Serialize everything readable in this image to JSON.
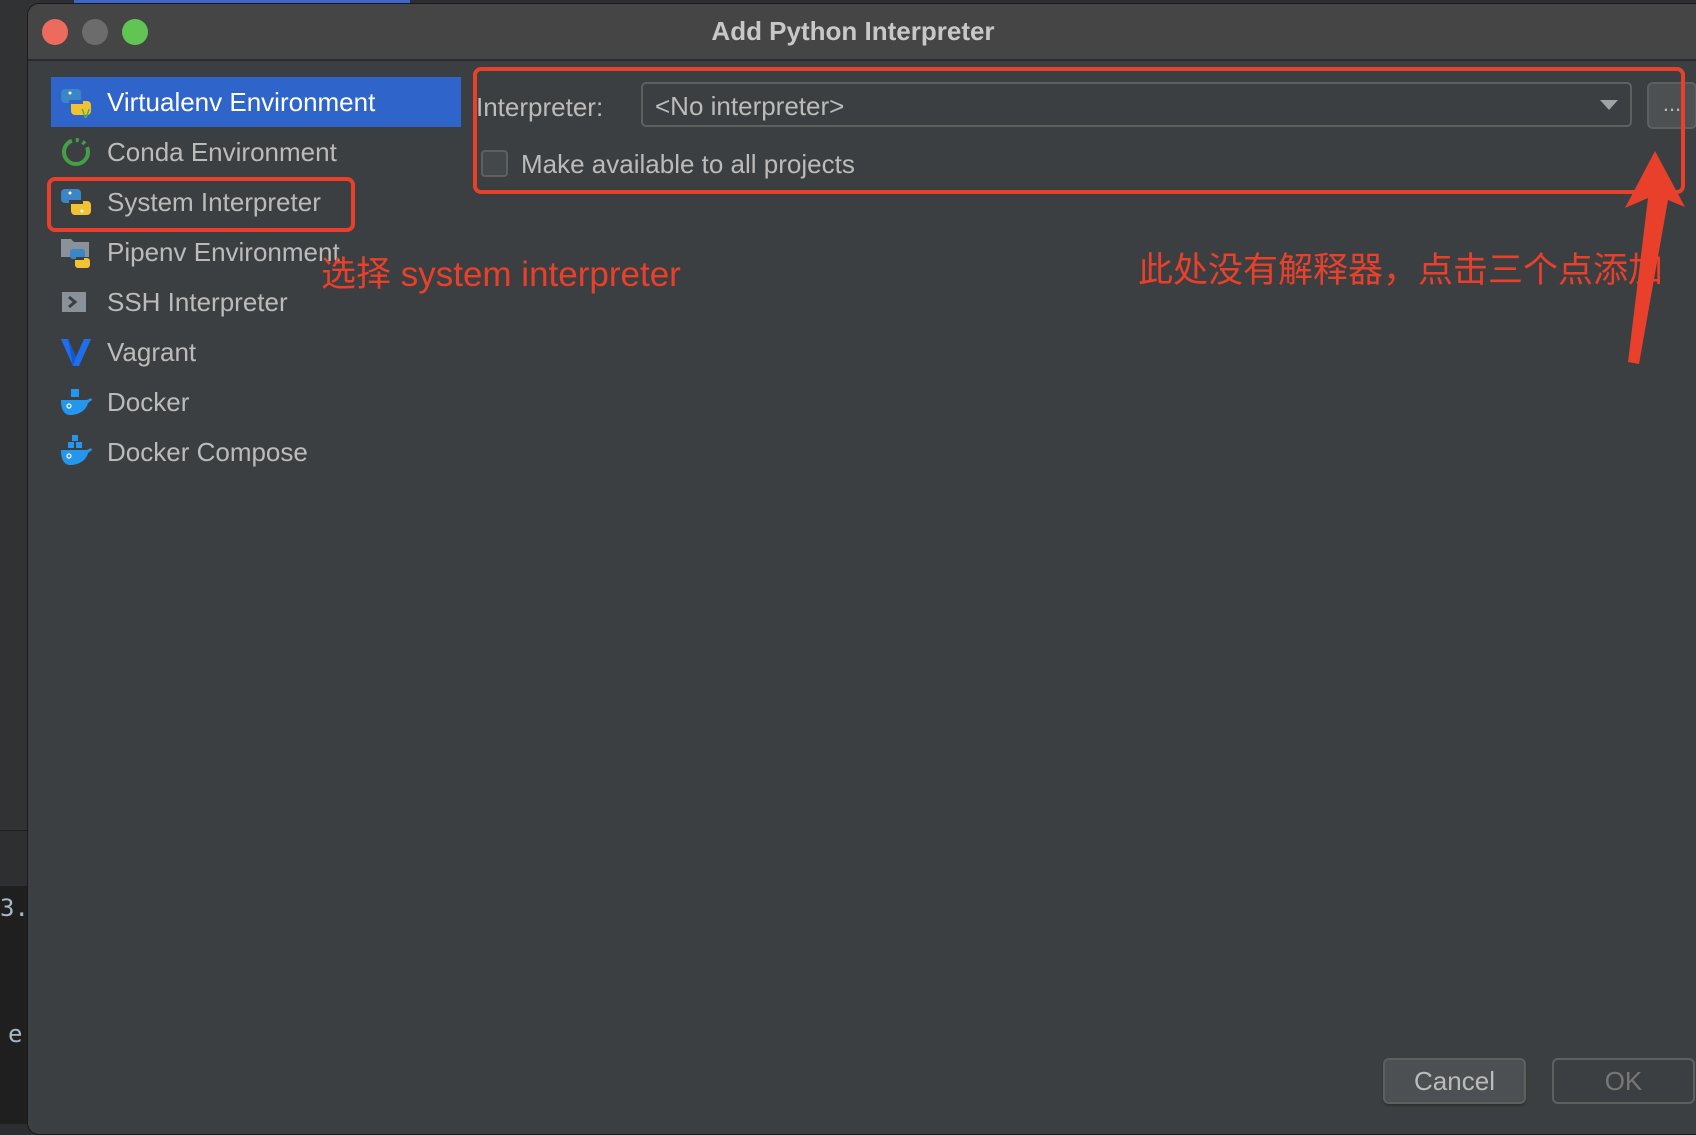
{
  "window": {
    "title": "Add Python Interpreter",
    "controls": [
      "close",
      "minimize",
      "maximize"
    ]
  },
  "background_ide": {
    "code_fragments": [
      "3.",
      "e"
    ]
  },
  "sidebar": {
    "items": [
      {
        "label": "Virtualenv Environment",
        "icon": "python-virtualenv-icon",
        "selected": true
      },
      {
        "label": "Conda Environment",
        "icon": "conda-ring-icon",
        "selected": false
      },
      {
        "label": "System Interpreter",
        "icon": "python-icon",
        "selected": false
      },
      {
        "label": "Pipenv Environment",
        "icon": "pipenv-folder-python-icon",
        "selected": false
      },
      {
        "label": "SSH Interpreter",
        "icon": "ssh-terminal-icon",
        "selected": false
      },
      {
        "label": "Vagrant",
        "icon": "vagrant-v-icon",
        "selected": false
      },
      {
        "label": "Docker",
        "icon": "docker-whale-icon",
        "selected": false
      },
      {
        "label": "Docker Compose",
        "icon": "docker-compose-icon",
        "selected": false
      }
    ]
  },
  "form": {
    "interpreter_label": "Interpreter:",
    "interpreter_value": "<No interpreter>",
    "browse_button_label": "...",
    "make_available_label": "Make available to all projects",
    "make_available_checked": false
  },
  "annotations": {
    "select_system": "选择 system interpreter",
    "no_interpreter_hint": "此处没有解释器，点击三个点添加",
    "highlight_color": "#e8402a"
  },
  "footer": {
    "cancel_label": "Cancel",
    "ok_label": "OK",
    "ok_enabled": false
  },
  "colors": {
    "dialog_bg": "#3c3f41",
    "titlebar_bg": "#454545",
    "selection_bg": "#2f65ca",
    "text": "#bbbbbb"
  }
}
